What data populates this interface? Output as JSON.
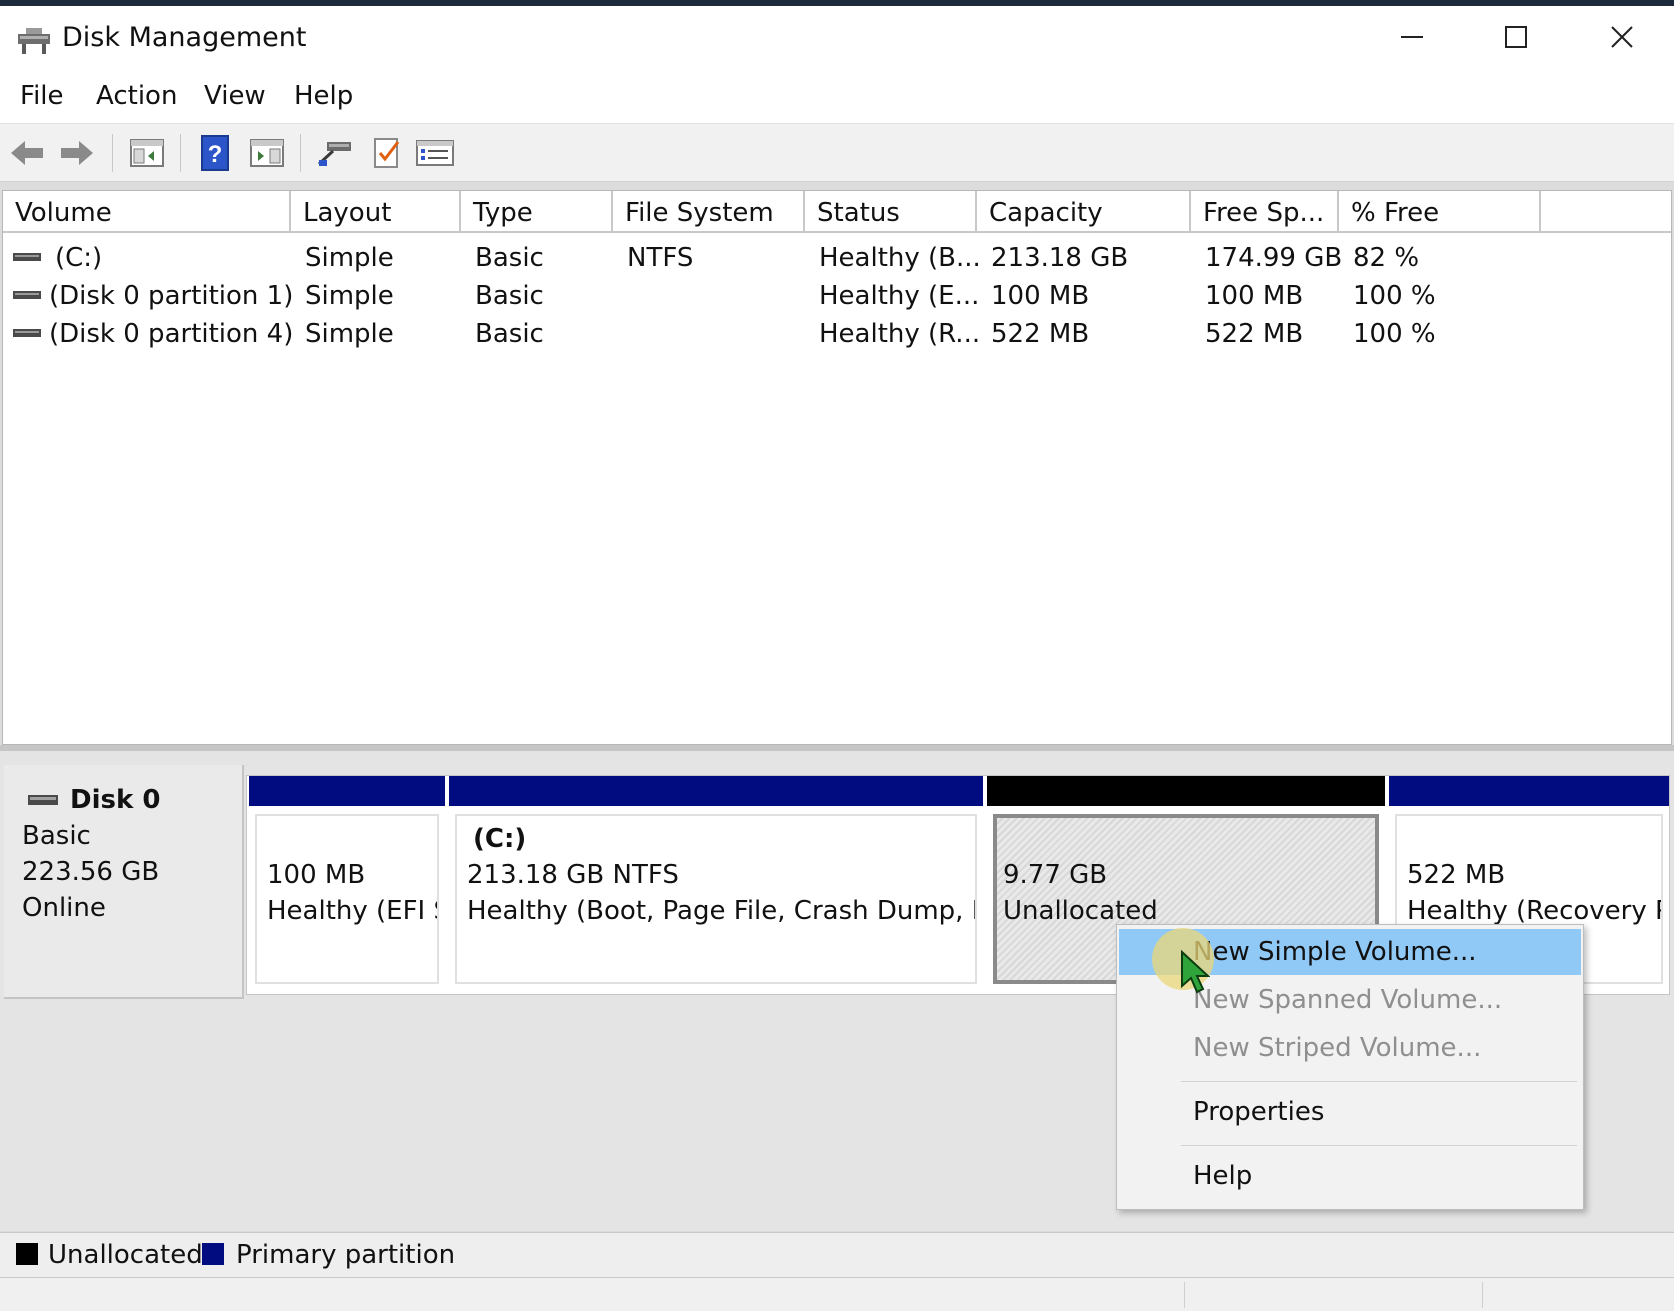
{
  "window": {
    "title": "Disk Management",
    "controls": {
      "minimize": "—",
      "maximize": "☐",
      "close": "✕"
    }
  },
  "menu": [
    "File",
    "Action",
    "View",
    "Help"
  ],
  "toolbar": {
    "icons": [
      "back-arrow-icon",
      "forward-arrow-icon",
      "console-tree-icon",
      "help-icon",
      "show-action-pane-icon",
      "connect-drive-icon",
      "check-list-icon",
      "properties-icon"
    ]
  },
  "volume_list": {
    "columns": [
      "Volume",
      "Layout",
      "Type",
      "File System",
      "Status",
      "Capacity",
      "Free Sp...",
      "% Free"
    ],
    "rows": [
      {
        "volume": "(C:)",
        "layout": "Simple",
        "type": "Basic",
        "file_system": "NTFS",
        "status": "Healthy (B...",
        "capacity": "213.18 GB",
        "free": "174.99 GB",
        "pct_free": "82 %"
      },
      {
        "volume": "(Disk 0 partition 1)",
        "layout": "Simple",
        "type": "Basic",
        "file_system": "",
        "status": "Healthy (E...",
        "capacity": "100 MB",
        "free": "100 MB",
        "pct_free": "100 %"
      },
      {
        "volume": "(Disk 0 partition 4)",
        "layout": "Simple",
        "type": "Basic",
        "file_system": "",
        "status": "Healthy (R...",
        "capacity": "522 MB",
        "free": "522 MB",
        "pct_free": "100 %"
      }
    ]
  },
  "disk": {
    "name": "Disk 0",
    "type": "Basic",
    "size": "223.56 GB",
    "status": "Online"
  },
  "partitions": [
    {
      "label": "",
      "size": "100 MB",
      "desc": "Healthy (EFI S",
      "bar_color": "#000c80"
    },
    {
      "label": "(C:)",
      "size": "213.18 GB NTFS",
      "desc": "Healthy (Boot, Page File, Crash Dump, Basi",
      "bar_color": "#000c80"
    },
    {
      "label": "",
      "size": "9.77 GB",
      "desc": "Unallocated",
      "bar_color": "#000000"
    },
    {
      "label": "",
      "size": "522 MB",
      "desc": "Healthy (Recovery Pa",
      "bar_color": "#000c80"
    }
  ],
  "context_menu": {
    "items": [
      {
        "label": "New Simple Volume...",
        "state": "highlighted"
      },
      {
        "label": "New Spanned Volume...",
        "state": "disabled"
      },
      {
        "label": "New Striped Volume...",
        "state": "disabled"
      },
      {
        "label": "Properties",
        "state": "enabled"
      },
      {
        "label": "Help",
        "state": "enabled"
      }
    ]
  },
  "legend": [
    {
      "label": "Unallocated",
      "color": "#000000"
    },
    {
      "label": "Primary partition",
      "color": "#000c80"
    }
  ]
}
